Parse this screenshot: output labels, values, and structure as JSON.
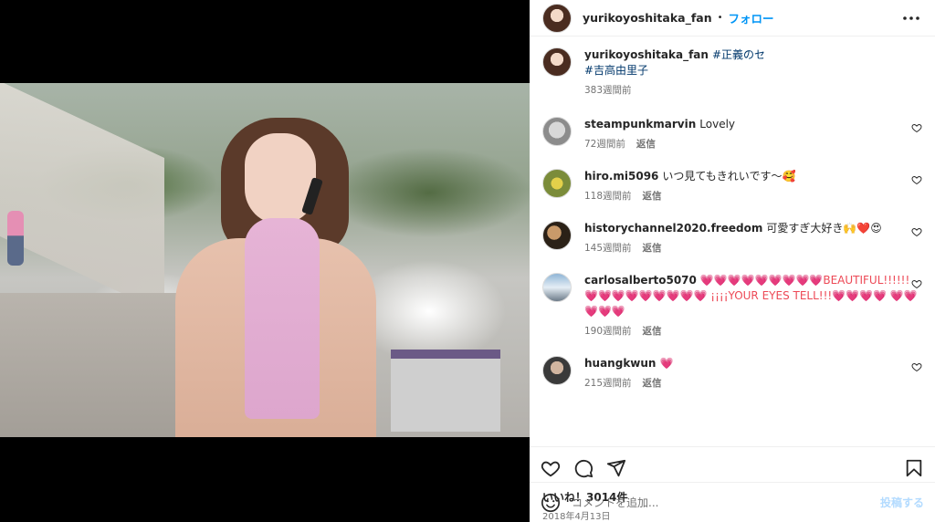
{
  "post": {
    "username": "yurikoyoshitaka_fan",
    "follow_label": "フォロー",
    "separator": "•",
    "caption_tags_line1": "#正義のセ",
    "caption_tags_line2": "#吉高由里子",
    "caption_time": "383週間前"
  },
  "comments": [
    {
      "user": "steampunkmarvin",
      "text": "Lovely",
      "extra": "",
      "time": "72週間前",
      "reply": "返信"
    },
    {
      "user": "hiro.mi5096",
      "text": "いつ見てもきれいです〜🥰",
      "extra": "",
      "time": "118週間前",
      "reply": "返信"
    },
    {
      "user": "historychannel2020.freedom",
      "text": "可愛すぎ大好き🙌❤️😍",
      "extra": "",
      "time": "145週間前",
      "reply": "返信"
    },
    {
      "user": "carlosalberto5070",
      "text": "💗💗💗💗💗💗💗💗💗BEAUTIFUL!!!!!!",
      "extra": "💗💗💗💗💗💗💗💗💗 ¡¡¡¡YOUR EYES TELL!!!💗💗💗💗 💗💗💗💗💗",
      "time": "190週間前",
      "reply": "返信"
    },
    {
      "user": "huangkwun",
      "text": "💗",
      "extra": "",
      "time": "215週間前",
      "reply": "返信"
    }
  ],
  "likes_label": "いいね！3014件",
  "date_label": "2018年4月13日",
  "add_comment": {
    "placeholder": "コメントを追加...",
    "post_label": "投稿する"
  },
  "colors": {
    "accent": "#0095f6",
    "heart": "#ed4956",
    "muted": "#737373"
  }
}
